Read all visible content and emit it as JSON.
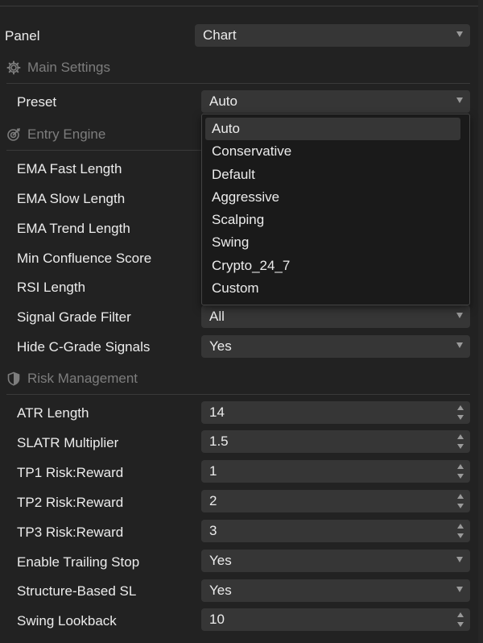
{
  "panel": {
    "label": "Panel",
    "value": "Chart"
  },
  "sections": {
    "main": "Main Settings",
    "entry": "Entry Engine",
    "risk": "Risk Management"
  },
  "preset": {
    "label": "Preset",
    "value": "Auto",
    "options": [
      "Auto",
      "Conservative",
      "Default",
      "Aggressive",
      "Scalping",
      "Swing",
      "Crypto_24_7",
      "Custom"
    ]
  },
  "entry": {
    "ema_fast": "EMA Fast Length",
    "ema_slow": "EMA Slow Length",
    "ema_trend": "EMA Trend Length",
    "min_confluence": "Min Confluence Score",
    "rsi_length": "RSI Length",
    "signal_grade": {
      "label": "Signal Grade Filter",
      "value": "All"
    },
    "hide_c": {
      "label": "Hide C-Grade Signals",
      "value": "Yes"
    }
  },
  "risk": {
    "atr_length": {
      "label": "ATR Length",
      "value": "14"
    },
    "sl_atr": {
      "label": "SLATR Multiplier",
      "value": "1.5"
    },
    "tp1": {
      "label": "TP1 Risk:Reward",
      "value": "1"
    },
    "tp2": {
      "label": "TP2 Risk:Reward",
      "value": "2"
    },
    "tp3": {
      "label": "TP3 Risk:Reward",
      "value": "3"
    },
    "trailing": {
      "label": "Enable Trailing Stop",
      "value": "Yes"
    },
    "structure_sl": {
      "label": "Structure-Based SL",
      "value": "Yes"
    },
    "swing_lookback": {
      "label": "Swing Lookback",
      "value": "10"
    }
  }
}
